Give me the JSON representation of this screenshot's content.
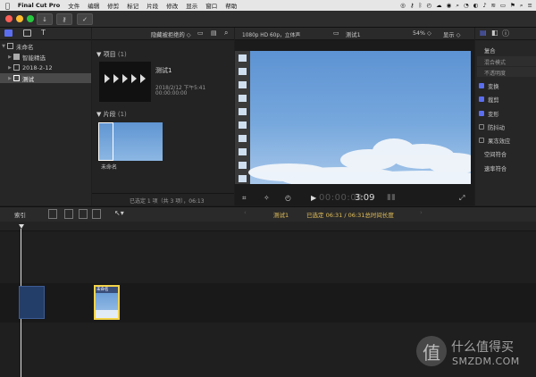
{
  "menu_bar": {
    "items": [
      "Final Cut Pro",
      "文件",
      "编辑",
      "修剪",
      "标记",
      "片段",
      "修改",
      "显示",
      "窗口",
      "帮助"
    ],
    "status_icons": [
      "creative-cloud-icon",
      "key-icon",
      "bluetooth-icon",
      "time-machine-icon",
      "cloud-icon",
      "record-icon",
      "search-icon",
      "timer-icon",
      "eye-icon",
      "volume-icon",
      "wifi-icon",
      "battery-icon",
      "flag-icon",
      "spotlight-icon",
      "menu-icon"
    ]
  },
  "toolbar": {
    "import_icon": "download-arrow-icon",
    "keywords_icon": "key-icon",
    "check_icon": "checkmark-circle-icon"
  },
  "sidebar": {
    "items": [
      {
        "label": "未命名",
        "level": 0,
        "icon": "library-grid-icon"
      },
      {
        "label": "智能精选",
        "level": 1,
        "icon": "folder-icon"
      },
      {
        "label": "2018-2-12",
        "level": 1,
        "icon": "event-star-icon"
      },
      {
        "label": "测试",
        "level": 1,
        "icon": "event-star-icon",
        "selected": true
      }
    ]
  },
  "browser": {
    "filter_label": "隐藏被拒绝的 ◇",
    "projects_header": "项目",
    "projects_count": "(1)",
    "project": {
      "name": "测试1",
      "date": "2018/2/12 下午5:41",
      "timecode": "00:00:00:00"
    },
    "clips_header": "片段",
    "clips_count": "(1)",
    "clip": {
      "name": "未命名"
    },
    "status": "已选定 1 项（共 3 项），06:13"
  },
  "viewer": {
    "format": "1080p HD 60p，立体声",
    "title": "测试1",
    "zoom": "54% ◇",
    "display_label": "显示 ◇",
    "timecode_dim": "00:00:00",
    "timecode": "3:09"
  },
  "inspector": {
    "section_title": "复合",
    "blend_mode": "混合模式",
    "opacity": "不透明度",
    "checks": [
      {
        "label": "变换",
        "checked": true
      },
      {
        "label": "裁剪",
        "checked": true
      },
      {
        "label": "变形",
        "checked": true
      },
      {
        "label": "防抖动",
        "checked": false
      },
      {
        "label": "果冻效应",
        "checked": false
      }
    ],
    "spatial": "空间符合",
    "rate": "速率符合"
  },
  "timeline": {
    "index_label": "索引",
    "project_name": "测试1",
    "selected_prefix": "已选定 ",
    "selected_time": "06:31",
    "total_suffix": " / 06:31总时间长度",
    "clip_label": "未命名"
  },
  "watermark": {
    "char": "值",
    "tagline": "什么值得买",
    "site": "SMZDM.COM"
  },
  "colors": {
    "accent": "#5b6ef0",
    "sky": "#6fa2d9",
    "selection_yellow": "#f3d34a",
    "timecode_yellow": "#e6c25a"
  }
}
